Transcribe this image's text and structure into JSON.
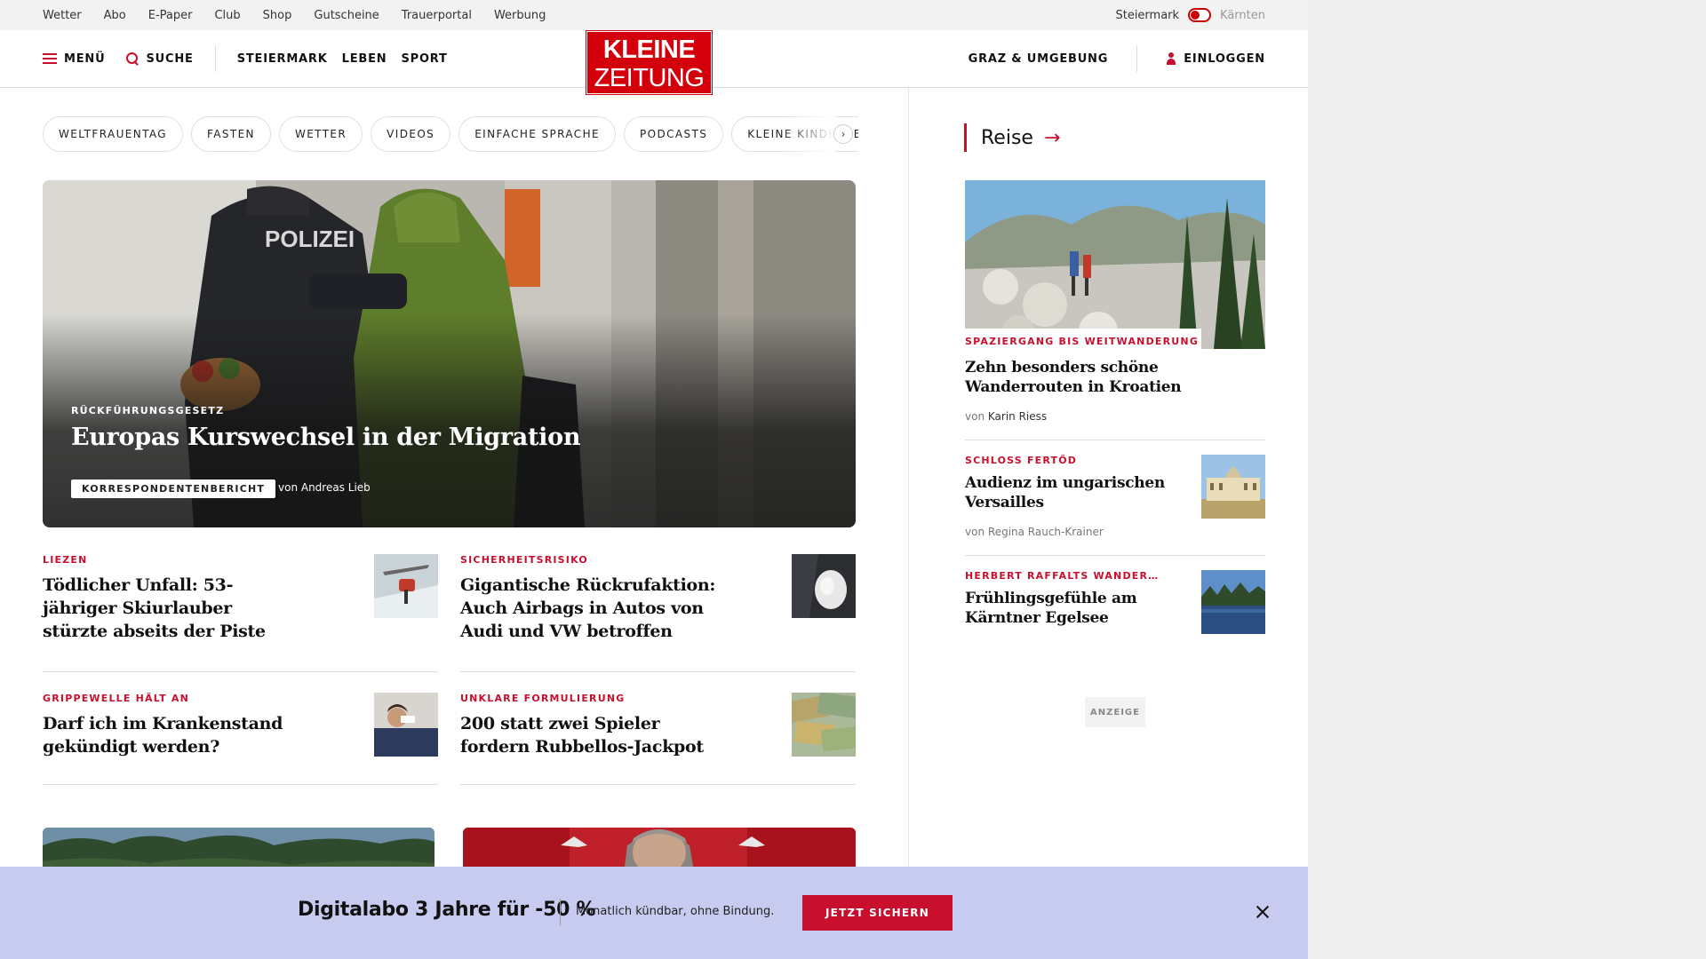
{
  "utility_nav": [
    "Wetter",
    "Abo",
    "E-Paper",
    "Club",
    "Shop",
    "Gutscheine",
    "Trauerportal",
    "Werbung"
  ],
  "region": {
    "active": "Steiermark",
    "inactive": "Kärnten"
  },
  "header": {
    "menu": "MENÜ",
    "search": "SUCHE",
    "nav": [
      "STEIERMARK",
      "LEBEN",
      "SPORT"
    ],
    "logo_line1": "KLEINE",
    "logo_line2": "ZEITUNG",
    "location": "GRAZ & UMGEBUNG",
    "login": "EINLOGGEN"
  },
  "pills": [
    "WELTFRAUENTAG",
    "FASTEN",
    "WETTER",
    "VIDEOS",
    "EINFACHE SPRACHE",
    "PODCASTS",
    "KLEINE KINDERZEI"
  ],
  "pill_next": "›",
  "hero": {
    "image_text": "POLIZEI",
    "kicker": "RÜCKFÜHRUNGSGESETZ",
    "title": "Europas Kurswechsel in der Migration",
    "badge": "KORRESPONDENTENBERICHT",
    "byline": "von Andreas Lieb"
  },
  "articles": [
    {
      "kicker": "LIEZEN",
      "title": "Tödlicher Unfall: 53-jähriger Skiurlauber stürzte abseits der Piste"
    },
    {
      "kicker": "SICHERHEITSRISIKO",
      "title": "Gigantische Rückrufaktion: Auch Airbags in Autos von Audi und VW betroffen"
    },
    {
      "kicker": "GRIPPEWELLE HÄLT AN",
      "title": "Darf ich im Krankenstand gekündigt werden?"
    },
    {
      "kicker": "UNKLARE FORMULIERUNG",
      "title": "200 statt zwei Spieler fordern Rubbellos-Jackpot"
    }
  ],
  "sidebar": {
    "section": "Reise",
    "arrow": "→",
    "items": [
      {
        "kicker": "SPAZIERGANG BIS WEITWANDERUNG",
        "title": "Zehn besonders schöne Wanderrouten in Kroatien",
        "by_prefix": "von",
        "author": "Karin Riess"
      },
      {
        "kicker": "SCHLOSS FERTŐD",
        "title": "Audienz im ungarischen Versailles",
        "by_prefix": "von",
        "author": "Regina Rauch-Krainer"
      },
      {
        "kicker": "HERBERT RAFFALTS WANDER…",
        "title": "Frühlingsgefühle am Kärntner Egelsee"
      }
    ],
    "ad_label": "ANZEIGE"
  },
  "promo": {
    "headline": "Digitalabo 3 Jahre für -50 %",
    "sub": "Monatlich kündbar, ohne Bindung.",
    "cta": "JETZT SICHERN"
  },
  "colors": {
    "brand_red": "#d3000b",
    "accent_red": "#c8102e",
    "promo_bg": "#c8cbf0"
  }
}
